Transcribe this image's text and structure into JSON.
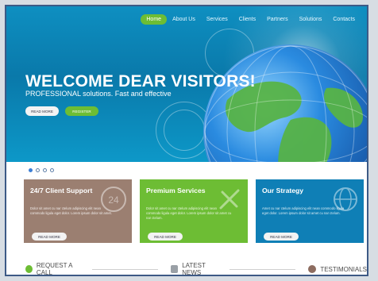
{
  "nav": {
    "items": [
      "Home",
      "About Us",
      "Services",
      "Clients",
      "Partners",
      "Solutions",
      "Contacts"
    ],
    "active_index": 0
  },
  "hero": {
    "title": "WELCOME DEAR VISITORS!",
    "subtitle": "PROFESSIONAL solutions. Fast and effective",
    "buttons": {
      "read_more": "READ MORE",
      "register": "REGISTER"
    }
  },
  "slider": {
    "dots": 4,
    "active_dot": 0
  },
  "cards": [
    {
      "title": "24/7 Client Support",
      "text": "Dolor sit amet cu nar ctelum adipiscing elit nean commodo ligula eget dolor. Lorem ipsum dolor sit amet.",
      "button": "READ MORE",
      "icon": "24-hours-icon",
      "color": "#9b7f71"
    },
    {
      "title": "Premium Services",
      "text": "Dolor sit amet cu nar ctelum adipiscing elit nean commodo ligula eget dolor. Lorem ipsum dolor sit amet cu nar ctelum.",
      "button": "READ MORE",
      "icon": "tools-icon",
      "color": "#6dbd34"
    },
    {
      "title": "Our Strategy",
      "text": "Amet cu nar ctelum adipiscing elit nean commodo ligula eget dolor. Lorem ipsum dolor sit amet cu nar ctelum.",
      "button": "READ MORE",
      "icon": "globe-icon",
      "color": "#0f7fb6"
    }
  ],
  "bottom_sections": [
    {
      "label": "REQUEST A CALL",
      "icon": "person-icon"
    },
    {
      "label": "LATEST NEWS",
      "icon": "calendar-icon"
    },
    {
      "label": "TESTIMONIALS",
      "icon": "speech-bubble-icon"
    }
  ],
  "colors": {
    "accent_green": "#6dbd34",
    "hero_blue": "#0a79aa",
    "frame_border": "#3d5a86"
  }
}
